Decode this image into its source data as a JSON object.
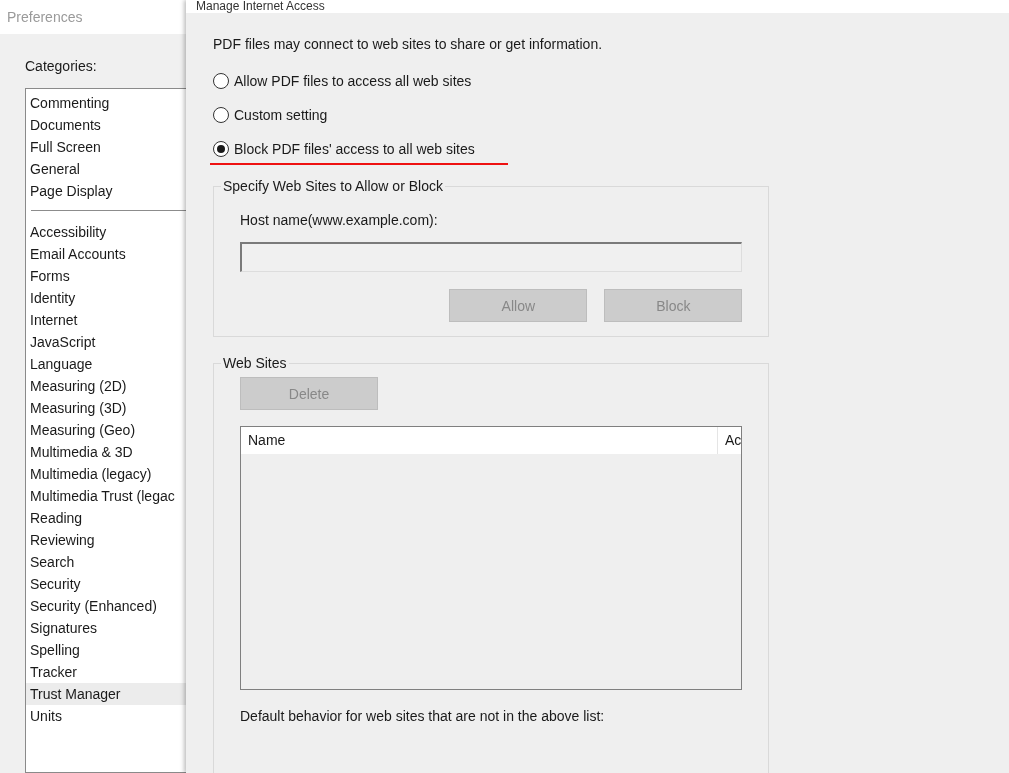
{
  "preferences": {
    "title": "Preferences",
    "categories_label": "Categories:",
    "sections": [
      {
        "items": [
          {
            "label": "Commenting",
            "selected": false
          },
          {
            "label": "Documents",
            "selected": false
          },
          {
            "label": "Full Screen",
            "selected": false
          },
          {
            "label": "General",
            "selected": false
          },
          {
            "label": "Page Display",
            "selected": false
          }
        ]
      },
      {
        "items": [
          {
            "label": "Accessibility",
            "selected": false
          },
          {
            "label": "Email Accounts",
            "selected": false
          },
          {
            "label": "Forms",
            "selected": false
          },
          {
            "label": "Identity",
            "selected": false
          },
          {
            "label": "Internet",
            "selected": false
          },
          {
            "label": "JavaScript",
            "selected": false
          },
          {
            "label": "Language",
            "selected": false
          },
          {
            "label": "Measuring (2D)",
            "selected": false
          },
          {
            "label": "Measuring (3D)",
            "selected": false
          },
          {
            "label": "Measuring (Geo)",
            "selected": false
          },
          {
            "label": "Multimedia & 3D",
            "selected": false
          },
          {
            "label": "Multimedia (legacy)",
            "selected": false
          },
          {
            "label": "Multimedia Trust (legac",
            "selected": false
          },
          {
            "label": "Reading",
            "selected": false
          },
          {
            "label": "Reviewing",
            "selected": false
          },
          {
            "label": "Search",
            "selected": false
          },
          {
            "label": "Security",
            "selected": false
          },
          {
            "label": "Security (Enhanced)",
            "selected": false
          },
          {
            "label": "Signatures",
            "selected": false
          },
          {
            "label": "Spelling",
            "selected": false
          },
          {
            "label": "Tracker",
            "selected": false
          },
          {
            "label": "Trust Manager",
            "selected": true
          },
          {
            "label": "Units",
            "selected": false
          }
        ]
      }
    ]
  },
  "dialog": {
    "title": "Manage Internet Access",
    "intro": "PDF files may connect to web sites to share or get information.",
    "options": [
      {
        "label": "Allow PDF files to access all web sites",
        "selected": false
      },
      {
        "label": "Custom setting",
        "selected": false
      },
      {
        "label": "Block PDF files' access to all web sites",
        "selected": true
      }
    ],
    "specify_group": {
      "legend": "Specify Web Sites to Allow or Block",
      "host_label": "Host name(www.example.com):",
      "buttons": [
        {
          "label": "Allow",
          "disabled": true
        },
        {
          "label": "Block",
          "disabled": true
        }
      ]
    },
    "sites_group": {
      "legend": "Web Sites",
      "delete_button": {
        "label": "Delete",
        "disabled": true
      },
      "columns": [
        "Name",
        "Ac"
      ]
    },
    "footer": "Default behavior for web sites that are not in the above list:"
  }
}
